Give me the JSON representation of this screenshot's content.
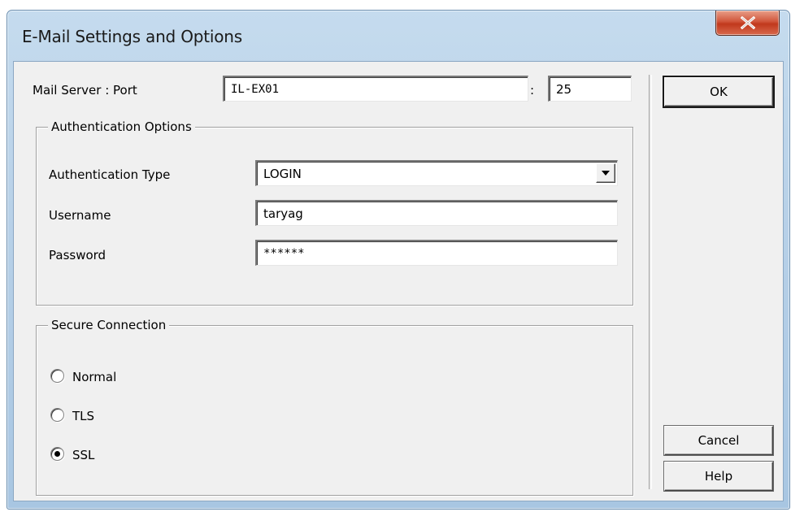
{
  "window": {
    "title": "E-Mail Settings and Options",
    "close_glyph": "X"
  },
  "server": {
    "label": "Mail Server : Port",
    "host": "IL-EX01",
    "separator": ":",
    "port": "25"
  },
  "auth": {
    "group_title": "Authentication Options",
    "type_label": "Authentication Type",
    "type_value": "LOGIN",
    "username_label": "Username",
    "username_value": "taryag",
    "password_label": "Password",
    "password_value": "******"
  },
  "secure": {
    "group_title": "Secure Connection",
    "options": [
      {
        "label": "Normal",
        "selected": false
      },
      {
        "label": "TLS",
        "selected": false
      },
      {
        "label": "SSL",
        "selected": true
      }
    ]
  },
  "buttons": {
    "ok": "OK",
    "cancel": "Cancel",
    "help": "Help"
  },
  "icons": {
    "close": "close-icon",
    "dropdown": "chevron-down-icon"
  },
  "colors": {
    "close_button": "#c8472a",
    "title_bar": "#b9d1ea",
    "client_bg": "#f0f0f0"
  }
}
